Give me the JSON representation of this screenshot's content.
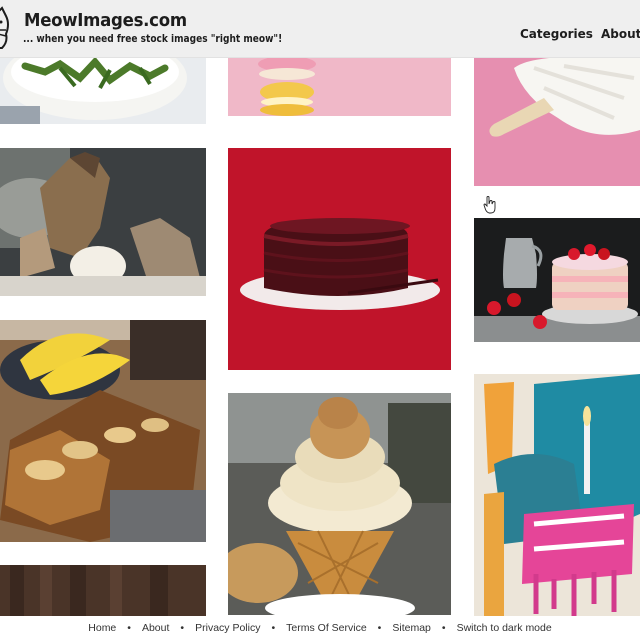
{
  "header": {
    "site_title": "MeowImages.com",
    "tagline": "... when you need free stock images \"right meow\"!",
    "nav": [
      {
        "label": "Categories"
      },
      {
        "label": "About"
      }
    ]
  },
  "gallery": {
    "tiles": [
      {
        "subject": "cake with cannabis leaves"
      },
      {
        "subject": "macarons"
      },
      {
        "subject": "coconut ice pop"
      },
      {
        "subject": "sculpture with cream"
      },
      {
        "subject": "red glazed chocolate cake"
      },
      {
        "subject": "strawberry cake with pitcher"
      },
      {
        "subject": "banana bread and bananas"
      },
      {
        "subject": "soft serve ice cream cone"
      },
      {
        "subject": "abstract painted birthday cake"
      },
      {
        "subject": "wooden dark image"
      }
    ]
  },
  "footer": {
    "links": [
      {
        "label": "Home"
      },
      {
        "label": "About"
      },
      {
        "label": "Privacy Policy"
      },
      {
        "label": "Terms Of Service"
      },
      {
        "label": "Sitemap"
      },
      {
        "label": "Switch to dark mode"
      }
    ],
    "separator": "•"
  },
  "colors": {
    "header_bg": "#efefef",
    "text": "#1d1d1d",
    "cake_red_bg": "#c0142a"
  }
}
